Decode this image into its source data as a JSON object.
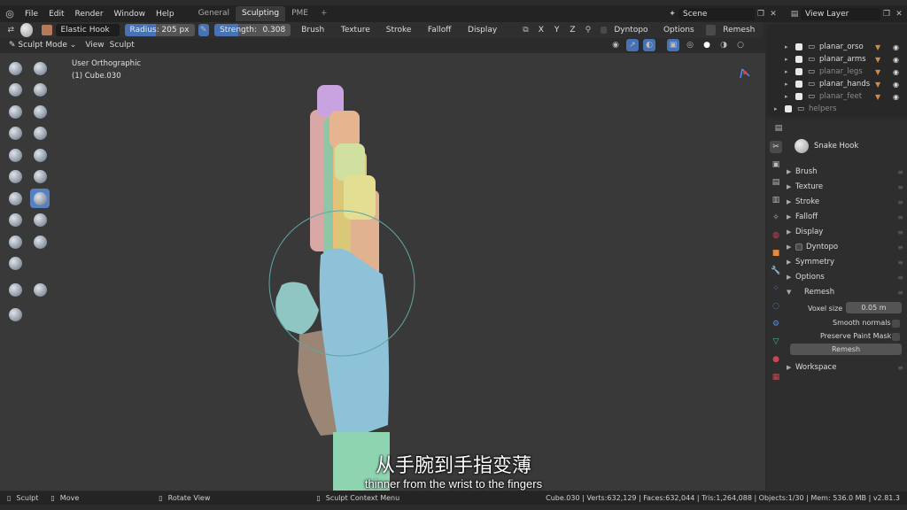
{
  "menu": {
    "items": [
      "File",
      "Edit",
      "Render",
      "Window",
      "Help"
    ]
  },
  "workspace_tabs": [
    {
      "label": "General"
    },
    {
      "label": "Sculpting"
    },
    {
      "label": "PME"
    },
    {
      "label": "+"
    }
  ],
  "scene": {
    "value": "Scene"
  },
  "view_layer": {
    "value": "View Layer"
  },
  "tool_header": {
    "brush_name": "Elastic Hook",
    "radius": {
      "label": "Radius:",
      "value": "205 px",
      "fraction": 0.45
    },
    "strength": {
      "label": "Strength:",
      "value": "0.308",
      "fraction": 0.308
    },
    "dropdowns": [
      "Brush",
      "Texture",
      "Stroke",
      "Falloff",
      "Display"
    ],
    "axes": [
      "X",
      "Y",
      "Z"
    ],
    "dyntopo": "Dyntopo",
    "options": "Options",
    "remesh": "Remesh"
  },
  "mode_header": {
    "mode": "Sculpt Mode",
    "view": "View",
    "sculpt": "Sculpt"
  },
  "viewport": {
    "view_name": "User Orthographic",
    "object": "(1) Cube.030"
  },
  "outliner": {
    "rows": [
      {
        "name": "planar_orso",
        "enabled": true
      },
      {
        "name": "planar_arms",
        "enabled": true
      },
      {
        "name": "planar_legs",
        "enabled": true
      },
      {
        "name": "planar_hands",
        "enabled": true
      },
      {
        "name": "planar_feet",
        "enabled": true
      },
      {
        "name": "helpers",
        "enabled": true
      }
    ]
  },
  "properties": {
    "brush_title": "Snake Hook",
    "sections": [
      "Brush",
      "Texture",
      "Stroke",
      "Falloff",
      "Display",
      "Dyntopo",
      "Symmetry",
      "Options",
      "Remesh"
    ],
    "remesh": {
      "voxel_size_label": "Voxel size",
      "voxel_size_value": "0.05 m",
      "smooth_normals": "Smooth normals",
      "preserve_paint_mask": "Preserve Paint Mask",
      "remesh_button": "Remesh"
    },
    "workspace": "Workspace"
  },
  "subtitles": {
    "zh": "从手腕到手指变薄",
    "en": "thinner from the wrist to the fingers"
  },
  "status": {
    "left1": "Sculpt",
    "left2": "Move",
    "left3": "Rotate View",
    "context": "Sculpt Context Menu",
    "stats": "Cube.030 | Verts:632,129 | Faces:632,044 | Tris:1,264,088 | Objects:1/30 | Mem: 536.0 MB | v2.81.3"
  },
  "colors": {
    "accent": "#4772b3",
    "tool_selected": "#5680c2",
    "viewport_bg": "#393939"
  }
}
